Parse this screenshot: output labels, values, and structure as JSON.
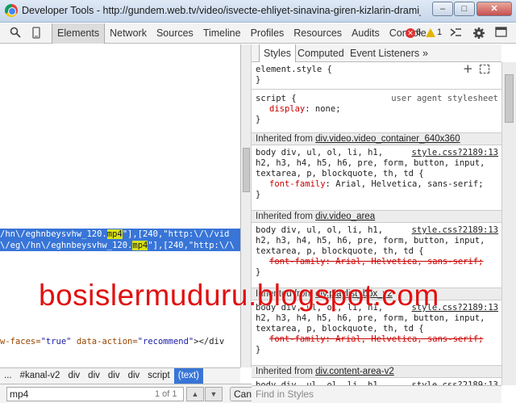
{
  "window": {
    "title": "Developer Tools - http://gundem.web.tv/video/isvecte-ehliyet-sinavina-giren-kizlarin-drami_...",
    "minimize": "–",
    "maximize": "□",
    "close": "✕"
  },
  "toolbar": {
    "tabs": [
      "Elements",
      "Network",
      "Sources",
      "Timeline",
      "Profiles",
      "Resources",
      "Audits",
      "Console"
    ],
    "errors": "6",
    "warnings": "1"
  },
  "code": {
    "line1_pre": "/hn\\/eghnbeysvhw_120.",
    "line1_hl": "mp4",
    "line1_post": "\"],[240,\"http:\\/\\/vid",
    "line2_pre": "\\/eg\\/hn\\/eghnbeysvhw_120.",
    "line2_hl": "mp4",
    "line2_post": "\"],[240,\"http:\\/\\",
    "line3_a": "w-faces=",
    "line3_b": "\"true\"",
    "line3_c": " data-action=",
    "line3_d": "\"recommend\"",
    "line3_e": "></div"
  },
  "breadcrumbs": [
    "...",
    "#kanal-v2",
    "div",
    "div",
    "div",
    "div",
    "script",
    "(text)"
  ],
  "search": {
    "value": "mp4",
    "count": "1 of 1",
    "cancel": "Cancel"
  },
  "styles": {
    "tabs": [
      "Styles",
      "Computed",
      "Event Listeners",
      "»"
    ],
    "element_style": "element.style {",
    "close_brace": "}",
    "script_selector": "script {",
    "ua_label": "user agent stylesheet",
    "display_prop": "display",
    "display_val": ": none;",
    "inherited_label": "Inherited from",
    "inh1_el": "div.video.video_container_640x360",
    "inh2_el": "div.video_area",
    "inh3_el": "div.playlist_box_v2",
    "inh4_el": "div.content-area-v2",
    "selector_l1": "body div, ul, ol, li, h1,",
    "selector_l2": "h2, h3, h4, h5, h6, pre, form, button, input,",
    "selector_l3": "textarea, p, blockquote, th, td {",
    "src": "style.css?2189:13",
    "ff_prop": "font-family",
    "ff_val": ": Arial, Helvetica, sans-serif;",
    "ff_struck": "font-family: Arial, Helvetica, sans-serif;",
    "find_placeholder": "Find in Styles"
  },
  "watermark": "bosislermuduru.blogspot.com"
}
